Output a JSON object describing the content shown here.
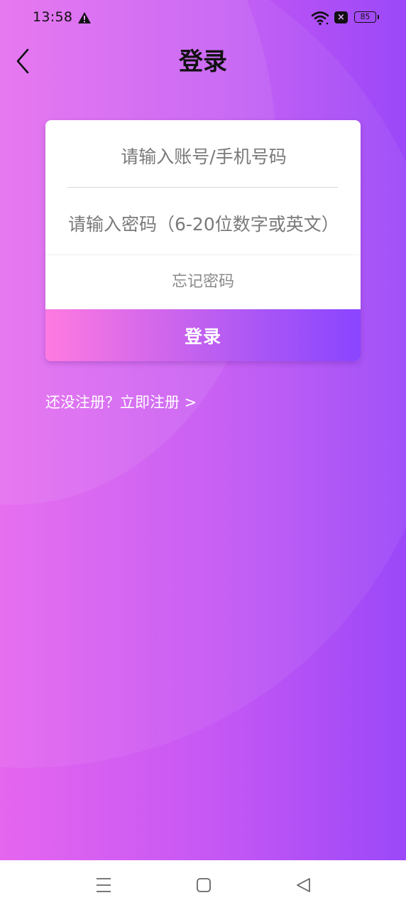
{
  "status_bar": {
    "time": "13:58",
    "battery": "85",
    "icons": [
      "alert-triangle-icon",
      "wifi-icon",
      "sim-x-icon",
      "battery-icon"
    ],
    "sim_badge": "×"
  },
  "header": {
    "title": "登录",
    "back_icon": "chevron-left-icon"
  },
  "login_form": {
    "account_placeholder": "请输入账号/手机号码",
    "account_value": "",
    "password_placeholder": "请输入密码（6-20位数字或英文）",
    "password_value": "",
    "forgot_password": "忘记密码",
    "submit_label": "登录"
  },
  "register_prompt": "还没注册？立即注册 >",
  "nav_bar": {
    "icons": [
      "menu-icon",
      "home-square-icon",
      "back-triangle-icon"
    ]
  },
  "colors": {
    "background_start": "#e566ef",
    "background_end": "#9b48f8",
    "button_start": "#ff7ae0",
    "button_end": "#8a45ff",
    "card": "#ffffff",
    "title": "#111111"
  }
}
